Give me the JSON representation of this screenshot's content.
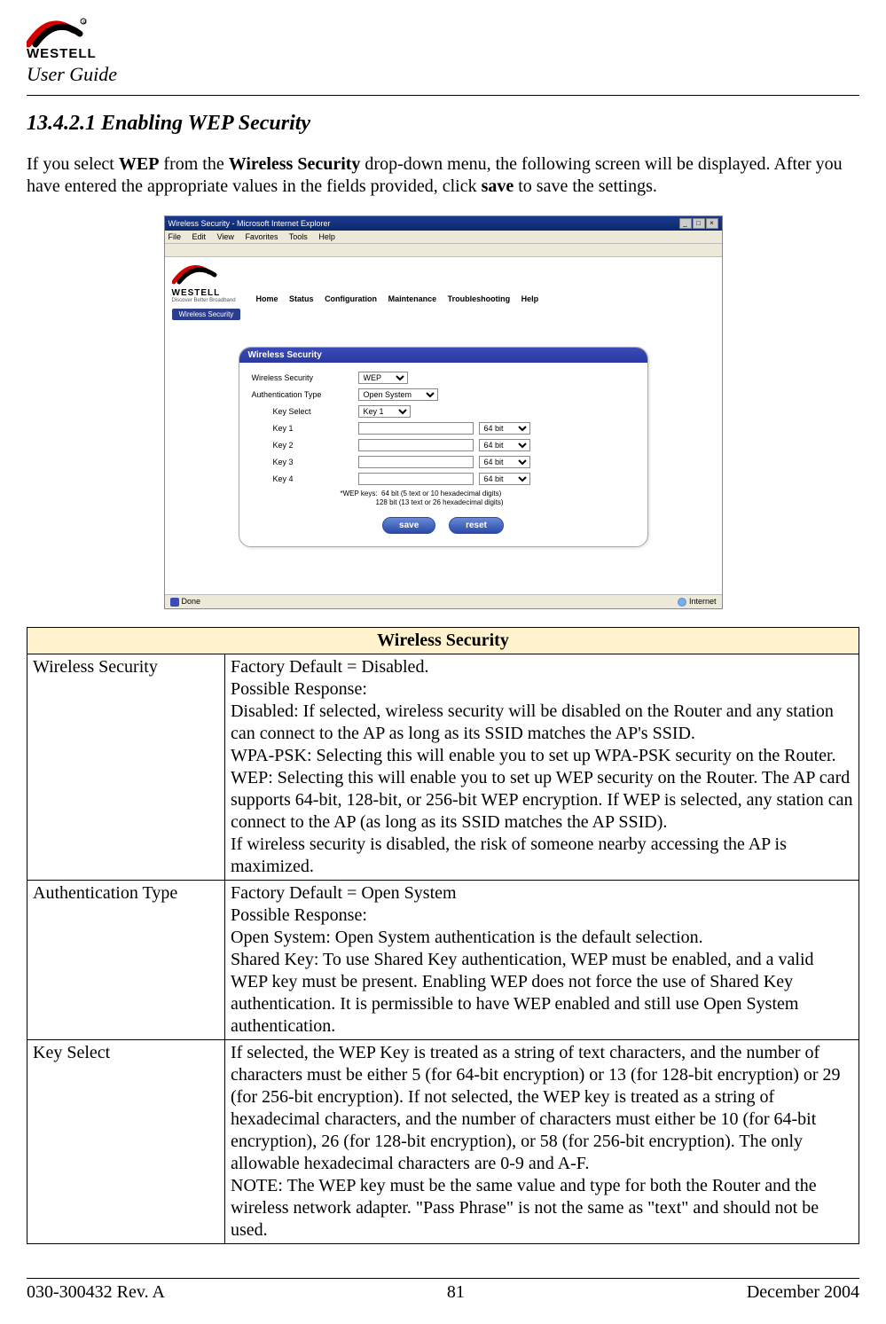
{
  "header": {
    "brand_upper": "WESTELL",
    "user_guide": "User Guide"
  },
  "section": {
    "number": "13.4.2.1",
    "title": "Enabling WEP Security"
  },
  "intro": {
    "pre": "If you select ",
    "b1": "WEP",
    "mid1": " from the ",
    "b2": "Wireless Security",
    "mid2": " drop-down menu, the following screen will be displayed. After you have entered the appropriate values in the fields provided, click ",
    "b3": "save",
    "post": " to save the settings."
  },
  "screenshot": {
    "window_title": "Wireless Security - Microsoft Internet Explorer",
    "menubar": [
      "File",
      "Edit",
      "View",
      "Favorites",
      "Tools",
      "Help"
    ],
    "brand": "WESTELL",
    "tagline": "Discover Better Broadband",
    "nav": [
      "Home",
      "Status",
      "Configuration",
      "Maintenance",
      "Troubleshooting",
      "Help"
    ],
    "tab": "Wireless Security",
    "panel_title": "Wireless Security",
    "rows": {
      "wireless_security_label": "Wireless Security",
      "wireless_security_value": "WEP",
      "auth_label": "Authentication Type",
      "auth_value": "Open System",
      "keysel_label": "Key Select",
      "keysel_value": "Key 1",
      "key1_label": "Key 1",
      "key2_label": "Key 2",
      "key3_label": "Key 3",
      "key4_label": "Key 4",
      "bits_value": "64 bit"
    },
    "note_prefix": "*WEP keys:",
    "note_line1": "64 bit (5 text or 10 hexadecimal digits)",
    "note_line2": "128 bit (13 text or 26 hexadecimal digits)",
    "save_btn": "save",
    "reset_btn": "reset",
    "status_done": "Done",
    "status_net": "Internet"
  },
  "table": {
    "header": "Wireless Security",
    "rows": [
      {
        "name": "Wireless Security",
        "desc": "Factory Default = Disabled.\nPossible Response:\nDisabled: If selected, wireless security will be disabled on the Router and any station can connect to the AP as long as its SSID matches the AP's SSID.\nWPA-PSK: Selecting this will enable you to set up WPA-PSK security on the Router.\nWEP: Selecting this will enable you to set up WEP security on the Router. The AP card supports 64-bit, 128-bit, or 256-bit WEP encryption. If WEP is selected, any station can connect to the AP (as long as its SSID matches the AP SSID).\nIf wireless security is disabled, the risk of someone nearby accessing the AP is maximized."
      },
      {
        "name": "Authentication Type",
        "desc": "Factory Default = Open System\nPossible Response:\nOpen System: Open System authentication is the default selection.\nShared Key: To use Shared Key authentication, WEP must be enabled, and a valid WEP key must be present. Enabling WEP does not force the use of Shared Key authentication. It is permissible to have WEP enabled and still use Open System authentication."
      },
      {
        "name": "Key Select",
        "desc": "If selected, the WEP Key is treated as a string of text characters, and the number of characters must be either 5 (for 64-bit encryption) or 13 (for 128-bit encryption) or 29 (for 256-bit encryption). If not selected, the WEP key is treated as a string of hexadecimal characters, and the number of characters must either be 10 (for 64-bit encryption), 26 (for 128-bit encryption), or 58 (for 256-bit encryption). The only allowable hexadecimal characters are 0-9 and A-F.\nNOTE: The WEP key must be the same value and type for both the Router and the wireless network adapter. \"Pass Phrase\" is not the same as \"text\" and should not be used."
      }
    ]
  },
  "footer": {
    "left": "030-300432 Rev. A",
    "center": "81",
    "right": "December 2004"
  }
}
